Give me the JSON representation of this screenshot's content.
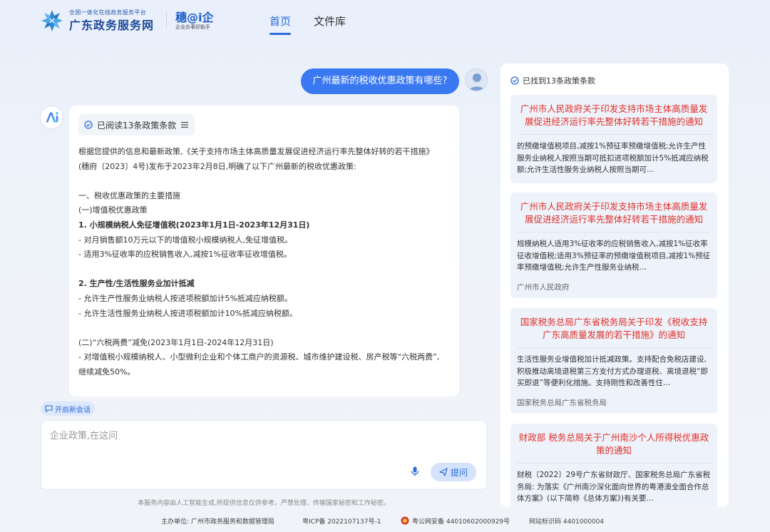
{
  "header": {
    "platform_small": "全国一体化在线政务服务平台",
    "platform_name": "广东政务服务网",
    "brand2_name": "穗@i企",
    "brand2_sub": "企业办事好助手",
    "nav": [
      "首页",
      "文件库"
    ]
  },
  "chat": {
    "question": "广州最新的税收优惠政策有哪些?",
    "read_tag": "已阅读13条政策条款",
    "answer_lines": [
      "根据您提供的信息和最新政策,《关于支持市场主体高质量发展促进经济运行率先整体好转的若干措施》",
      "(穗府〔2023〕4号)发布于2023年2月8日,明确了以下广州最新的税收优惠政策:",
      "",
      "一、税收优惠政策的主要措施",
      "(一)增值税优惠政策",
      "1. 小规模纳税人免征增值税(2023年1月1日-2023年12月31日)",
      "- 对月销售额10万元以下的增值税小规模纳税人,免征增值税。",
      "- 适用3%征收率的应税销售收入,减按1%征收率征收增值税。",
      "",
      "2. 生产性/生活性服务业加计抵减",
      "- 允许生产性服务业纳税人按进项税额加计5%抵减应纳税额。",
      "- 允许生活性服务业纳税人按进项税额加计10%抵减应纳税额。",
      "",
      "(二)“六税两费”减免(2023年1月1日-2024年12月31日)",
      "- 对增值税小规模纳税人、小型微利企业和个体工商户的资源税、城市维护建设税、房产税等“六税两费”,",
      "继续减免50%。"
    ],
    "new_chat": "开启新会话",
    "input_placeholder": "企业政策,在这问",
    "ask_button": "提问",
    "disclaimer": "本服务内容由人工智能生成,所提供信息仅供参考。严禁处理、传输国家秘密和工作秘密。"
  },
  "panel": {
    "header": "已找到13条政策条款",
    "cards": [
      {
        "title": "广州市人民政府关于印发支持市场主体高质量发展促进经济运行率先整体好转若干措施的通知",
        "text": "的预缴增值税项目,减按1%预征率预缴增值税;允许生产性服务业纳税人按照当期可抵扣进项税额加计5%抵减应纳税额;允许生活性服务业纳税人按照当期可…",
        "source": ""
      },
      {
        "title": "广州市人民政府关于印发支持市场主体高质量发展促进经济运行率先整体好转若干措施的通知",
        "text": "规模纳税人适用3%征收率的应税销售收入,减按1%征收率征收增值税;适用3%预征率的预缴增值税项目,减按1%预征率预缴增值税;允许生产性服务业纳税…",
        "source": "广州市人民政府"
      },
      {
        "title": "国家税务总局广东省税务局关于印发《税收支持广东高质量发展的若干措施》的通知",
        "text": "生活性服务业增值税加计抵减政策。支持配合免税店建设,积极推动离境退税第三方支付方式办理退税、离境退税“即买即退”等便利化措施。支持刚性和改善性住…",
        "source": "国家税务总局广东省税务局"
      },
      {
        "title": "财政部 税务总局关于广州南沙个人所得税优惠政策的通知",
        "text": "财税〔2022〕29号广东省财政厅、国家税务总局广东省税务局:  为落实《广州南沙深化面向世界的粤港澳全面合作总体方案》(以下简称《总体方案》)有关要…",
        "source": ""
      }
    ]
  },
  "footer": {
    "sponsor": "主办单位: 广州市政务服务和数据管理局",
    "icp": "粤ICP备 2022107137号-1",
    "police": "粤公网安备 44010602000929号",
    "site_code": "网站标识码 4401000004"
  },
  "colors": {
    "accent": "#3a78f2",
    "title_red": "#e0302a",
    "card_bg": "#eef3fb"
  }
}
